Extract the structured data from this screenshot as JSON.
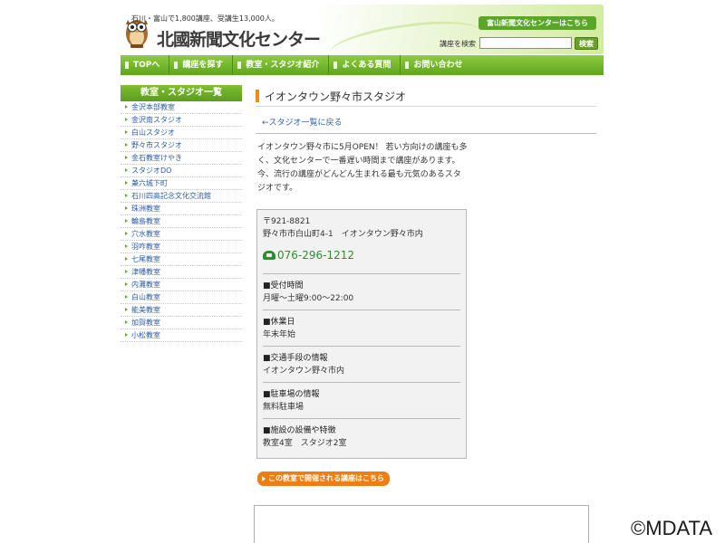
{
  "header": {
    "tagline": "石川・富山で1,800講座、受講生13,000人。",
    "logo_text": "北國新聞文化センター",
    "toyama_link": "富山新聞文化センターはこちら",
    "search_label": "講座を検索",
    "search_value": "",
    "search_button": "検索"
  },
  "nav": {
    "items": [
      "TOPへ",
      "講座を探す",
      "教室・スタジオ紹介",
      "よくある質問",
      "お問い合わせ"
    ]
  },
  "sidebar": {
    "title": "教室・スタジオ一覧",
    "items": [
      "金沢本部教室",
      "金沢南スタジオ",
      "白山スタジオ",
      "野々市スタジオ",
      "金石教室けやき",
      "スタジオDO",
      "兼六城下町",
      "石川四高記念文化交流館",
      "珠洲教室",
      "輪島教室",
      "穴水教室",
      "羽咋教室",
      "七尾教室",
      "津幡教室",
      "内灘教室",
      "白山教室",
      "能美教室",
      "加賀教室",
      "小松教室"
    ]
  },
  "main": {
    "title": "イオンタウン野々市スタジオ",
    "back_link": "←スタジオ一覧に戻る",
    "intro": "イオンタウン野々市に5月OPEN！ 若い方向けの講座も多く、文化センターで一番遅い時間まで講座があります。今、流行の講座がどんどん生まれる最も元気のあるスタジオです。",
    "postal": "〒921-8821",
    "address": "野々市市白山町4-1　イオンタウン野々市内",
    "phone": "076-296-1212",
    "sections": [
      {
        "heading": "■受付時間",
        "value": "月曜～土曜9:00～22:00"
      },
      {
        "heading": "■休業日",
        "value": "年末年始"
      },
      {
        "heading": "■交通手段の情報",
        "value": "イオンタウン野々市内"
      },
      {
        "heading": "■駐車場の情報",
        "value": "無料駐車場"
      },
      {
        "heading": "■施設の設備や特徴",
        "value": "教室4室　スタジオ2室"
      }
    ],
    "course_button": "この教室で開催される講座はこちら"
  },
  "watermark": "©MDATA",
  "colors": {
    "accent_green": "#5ea51f",
    "orange": "#f07d11",
    "link_blue": "#2a5fa8",
    "phone_green": "#2f8c2f"
  }
}
